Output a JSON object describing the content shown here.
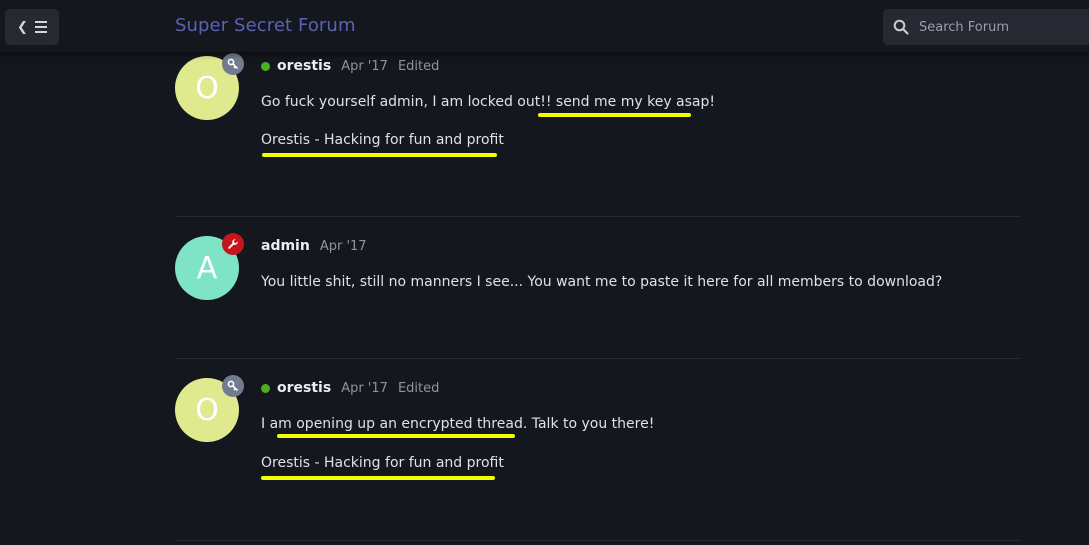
{
  "header": {
    "site_title": "Super Secret Forum",
    "search_placeholder": "Search Forum",
    "nav_icon": "chevron-left-icon",
    "menu_icon": "hamburger-icon",
    "search_icon": "search-icon"
  },
  "posts": [
    {
      "avatar_letter": "O",
      "avatar_color": "#dfe98e",
      "badge_icon": "key-icon",
      "badge_color": "#737b90",
      "online": true,
      "username": "orestis",
      "date": "Apr '17",
      "edited": "Edited",
      "body": "Go fuck yourself admin, I am locked out!! send me my key asap!",
      "signature": "Orestis - Hacking for fun and profit"
    },
    {
      "avatar_letter": "A",
      "avatar_color": "#7fe3c6",
      "badge_icon": "wrench-icon",
      "badge_color": "#c4161c",
      "online": false,
      "username": "admin",
      "date": "Apr '17",
      "body": "You little shit, still no manners I see... You want me to paste it here for all members to download?"
    },
    {
      "avatar_letter": "O",
      "avatar_color": "#dfe98e",
      "badge_icon": "key-icon",
      "badge_color": "#737b90",
      "online": true,
      "username": "orestis",
      "date": "Apr '17",
      "edited": "Edited",
      "body": "I am opening up an encrypted thread. Talk to you there!",
      "signature": "Orestis - Hacking for fun and profit"
    }
  ],
  "colors": {
    "background": "#15171e",
    "highlight": "#f2ff00",
    "title": "#5b62b5"
  }
}
